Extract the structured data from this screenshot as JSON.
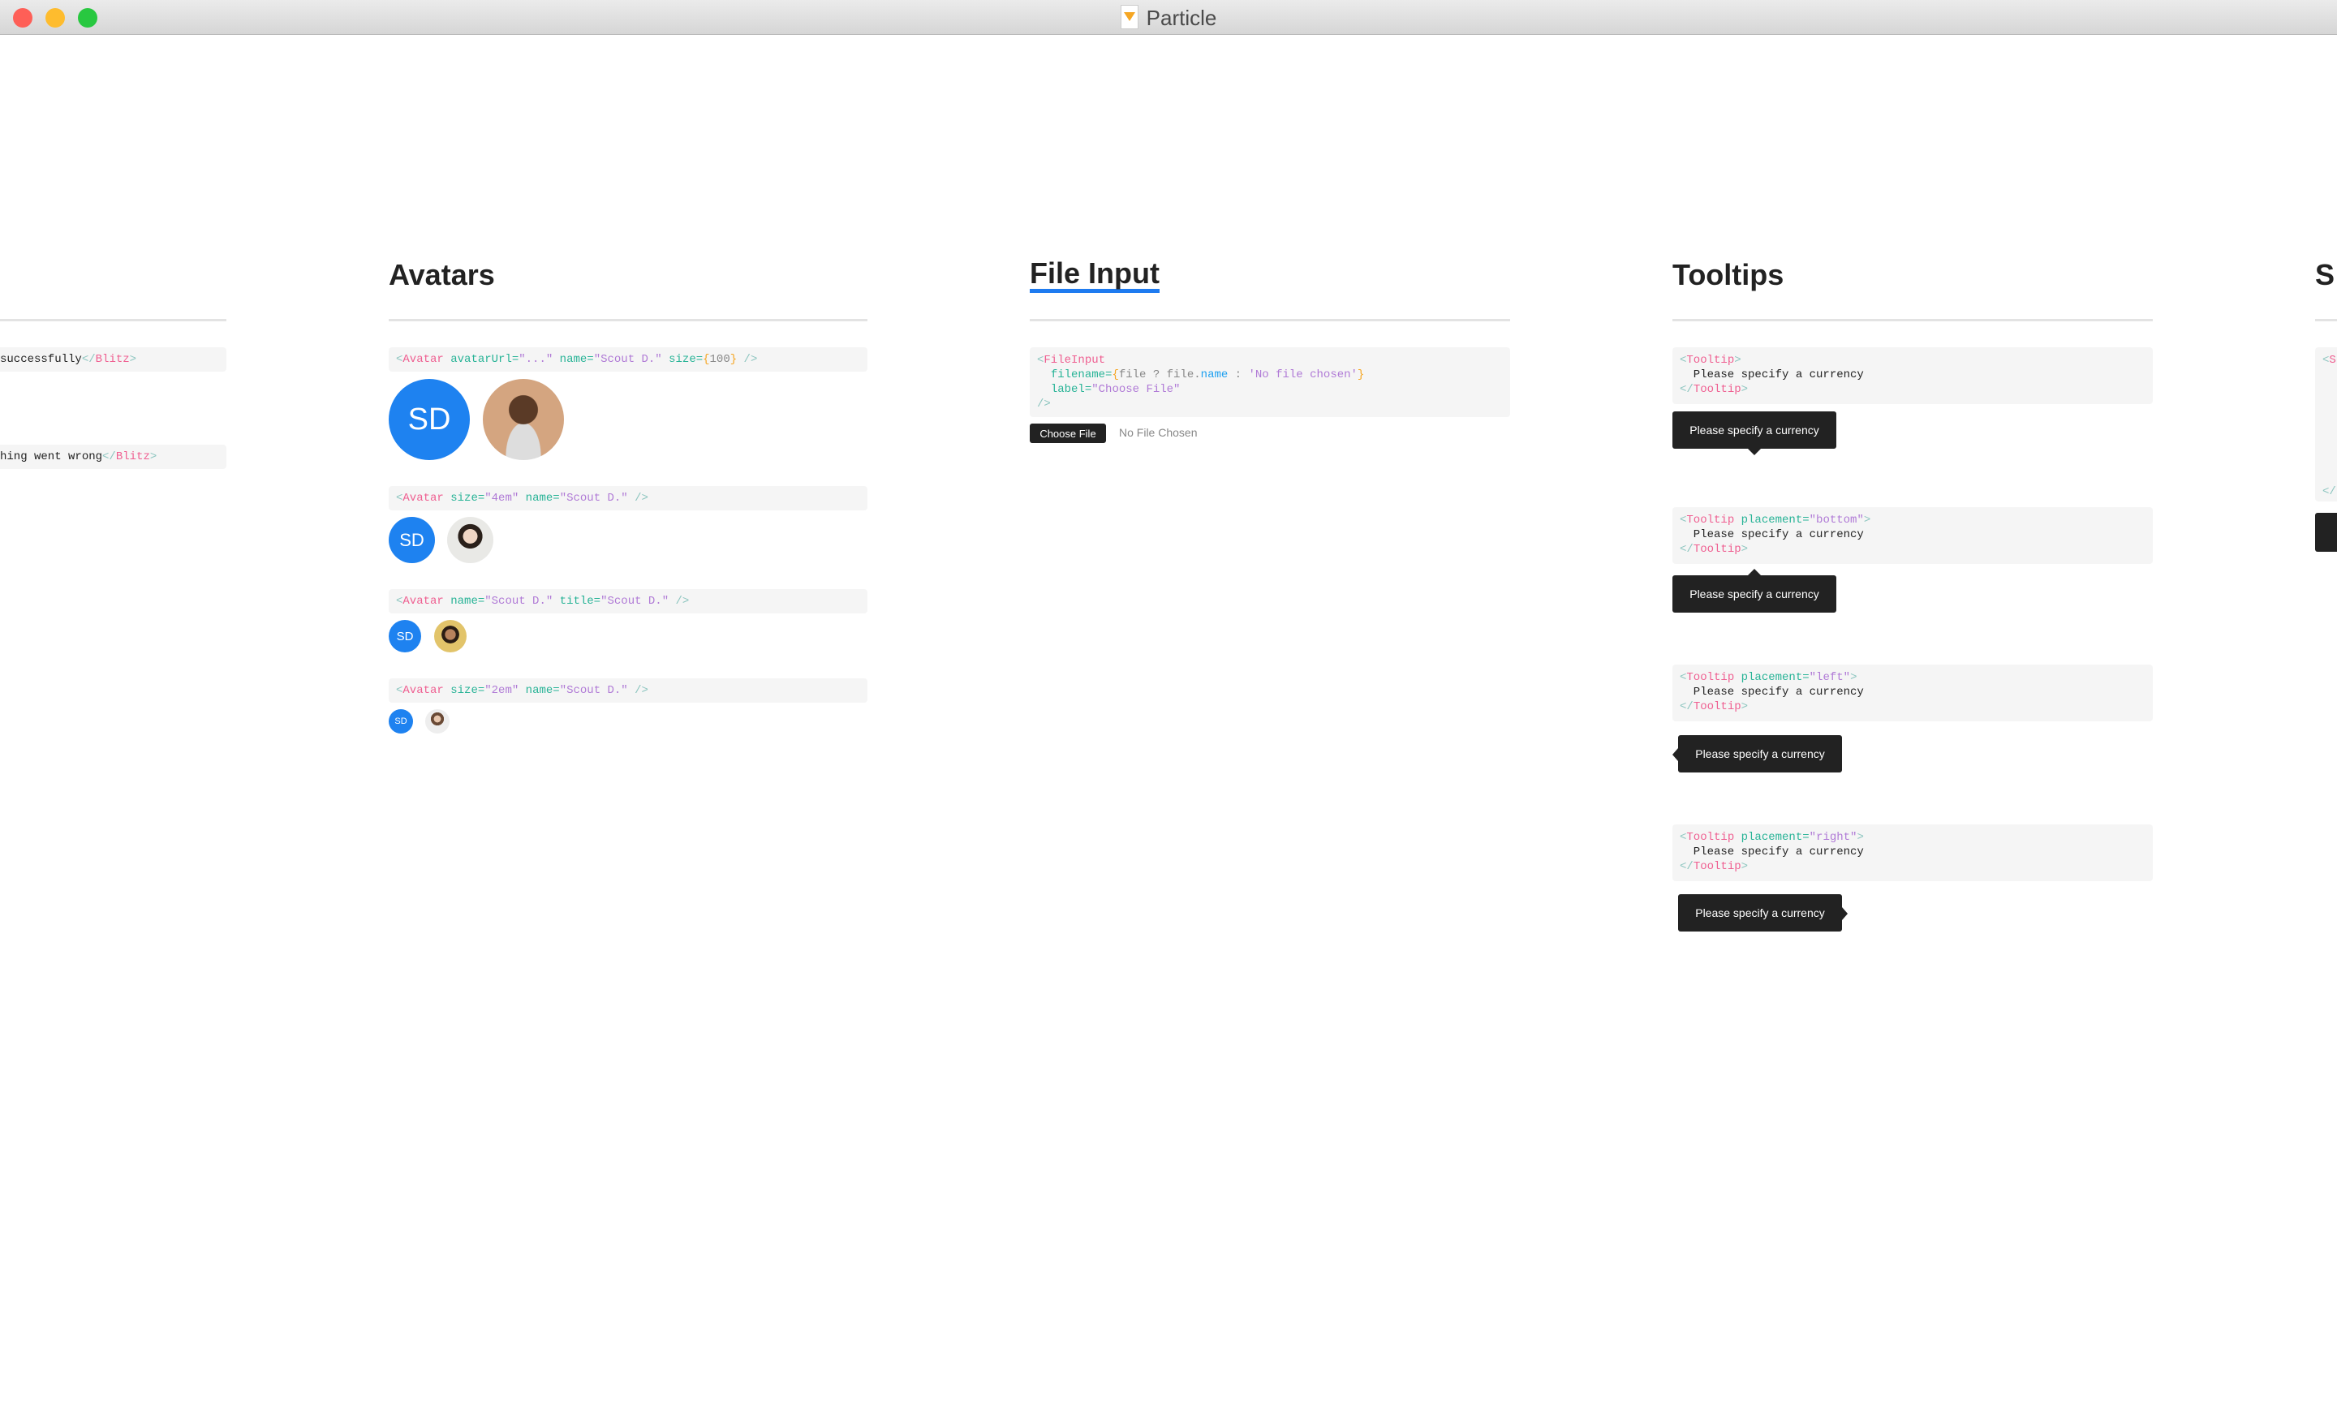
{
  "window": {
    "title": "Particle",
    "app_icon": "sketch-document-icon",
    "traffic_lights": [
      "#fe5f57",
      "#febc2e",
      "#28c840"
    ]
  },
  "colors": {
    "avatar_bg": "#1e82f0",
    "code_bg": "#f5f5f5",
    "tooltip_bg": "#222222",
    "heading_underline": "#1e7bf0"
  },
  "left_column": {
    "snippets": [
      [
        [
          [
            "text",
            "successfully"
          ],
          [
            "br",
            "</"
          ],
          [
            "tag",
            "Blitz"
          ],
          [
            "br",
            ">"
          ]
        ]
      ],
      [
        [
          [
            "text",
            "hing went wrong"
          ],
          [
            "br",
            "</"
          ],
          [
            "tag",
            "Blitz"
          ],
          [
            "br",
            ">"
          ]
        ]
      ]
    ]
  },
  "avatars": {
    "heading": "Avatars",
    "examples": [
      {
        "code": [
          [
            [
              "br",
              "<"
            ],
            [
              "tag",
              "Avatar"
            ],
            [
              "text",
              " "
            ],
            [
              "attr",
              "avatarUrl="
            ],
            [
              "str",
              "\"...\""
            ],
            [
              "text",
              " "
            ],
            [
              "attr",
              "name="
            ],
            [
              "str",
              "\"Scout D.\""
            ],
            [
              "text",
              " "
            ],
            [
              "attr",
              "size="
            ],
            [
              "brace",
              "{"
            ],
            [
              "plain",
              "100"
            ],
            [
              "brace",
              "}"
            ],
            [
              "br",
              " />"
            ]
          ]
        ],
        "initials": "SD"
      },
      {
        "code": [
          [
            [
              "br",
              "<"
            ],
            [
              "tag",
              "Avatar"
            ],
            [
              "text",
              " "
            ],
            [
              "attr",
              "size="
            ],
            [
              "str",
              "\"4em\""
            ],
            [
              "text",
              " "
            ],
            [
              "attr",
              "name="
            ],
            [
              "str",
              "\"Scout D.\""
            ],
            [
              "br",
              " />"
            ]
          ]
        ],
        "initials": "SD"
      },
      {
        "code": [
          [
            [
              "br",
              "<"
            ],
            [
              "tag",
              "Avatar"
            ],
            [
              "text",
              " "
            ],
            [
              "attr",
              "name="
            ],
            [
              "str",
              "\"Scout D.\""
            ],
            [
              "text",
              " "
            ],
            [
              "attr",
              "title="
            ],
            [
              "str",
              "\"Scout D.\""
            ],
            [
              "br",
              " />"
            ]
          ]
        ],
        "initials": "SD"
      },
      {
        "code": [
          [
            [
              "br",
              "<"
            ],
            [
              "tag",
              "Avatar"
            ],
            [
              "text",
              " "
            ],
            [
              "attr",
              "size="
            ],
            [
              "str",
              "\"2em\""
            ],
            [
              "text",
              " "
            ],
            [
              "attr",
              "name="
            ],
            [
              "str",
              "\"Scout D.\""
            ],
            [
              "br",
              " />"
            ]
          ]
        ],
        "initials": "SD"
      }
    ]
  },
  "file_input": {
    "heading": "File Input",
    "code": [
      [
        [
          "br",
          "<"
        ],
        [
          "tag",
          "FileInput"
        ]
      ],
      [
        [
          "text",
          "  "
        ],
        [
          "attr",
          "filename="
        ],
        [
          "brace",
          "{"
        ],
        [
          "plain",
          "file ? file."
        ],
        [
          "prop",
          "name"
        ],
        [
          "plain",
          " : "
        ],
        [
          "str",
          "'No file chosen'"
        ],
        [
          "brace",
          "}"
        ]
      ],
      [
        [
          "text",
          "  "
        ],
        [
          "attr",
          "label="
        ],
        [
          "str",
          "\"Choose File\""
        ]
      ],
      [
        [
          "br",
          "/>"
        ]
      ]
    ],
    "button_label": "Choose File",
    "status": "No File Chosen"
  },
  "tooltips": {
    "heading": "Tooltips",
    "examples": [
      {
        "code": [
          [
            [
              "br",
              "<"
            ],
            [
              "tag",
              "Tooltip"
            ],
            [
              "br",
              ">"
            ]
          ],
          [
            [
              "text",
              "  Please specify a currency"
            ]
          ],
          [
            [
              "br",
              "</"
            ],
            [
              "tag",
              "Tooltip"
            ],
            [
              "br",
              ">"
            ]
          ]
        ],
        "text": "Please specify a currency",
        "placement": "top"
      },
      {
        "code": [
          [
            [
              "br",
              "<"
            ],
            [
              "tag",
              "Tooltip"
            ],
            [
              "text",
              " "
            ],
            [
              "attr",
              "placement="
            ],
            [
              "str",
              "\"bottom\""
            ],
            [
              "br",
              ">"
            ]
          ],
          [
            [
              "text",
              "  Please specify a currency"
            ]
          ],
          [
            [
              "br",
              "</"
            ],
            [
              "tag",
              "Tooltip"
            ],
            [
              "br",
              ">"
            ]
          ]
        ],
        "text": "Please specify a currency",
        "placement": "bottom"
      },
      {
        "code": [
          [
            [
              "br",
              "<"
            ],
            [
              "tag",
              "Tooltip"
            ],
            [
              "text",
              " "
            ],
            [
              "attr",
              "placement="
            ],
            [
              "str",
              "\"left\""
            ],
            [
              "br",
              ">"
            ]
          ],
          [
            [
              "text",
              "  Please specify a currency"
            ]
          ],
          [
            [
              "br",
              "</"
            ],
            [
              "tag",
              "Tooltip"
            ],
            [
              "br",
              ">"
            ]
          ]
        ],
        "text": "Please specify a currency",
        "placement": "left"
      },
      {
        "code": [
          [
            [
              "br",
              "<"
            ],
            [
              "tag",
              "Tooltip"
            ],
            [
              "text",
              " "
            ],
            [
              "attr",
              "placement="
            ],
            [
              "str",
              "\"right\""
            ],
            [
              "br",
              ">"
            ]
          ],
          [
            [
              "text",
              "  Please specify a currency"
            ]
          ],
          [
            [
              "br",
              "</"
            ],
            [
              "tag",
              "Tooltip"
            ],
            [
              "br",
              ">"
            ]
          ]
        ],
        "text": "Please specify a currency",
        "placement": "right"
      }
    ]
  },
  "next_column": {
    "heading": "S",
    "code": [
      [
        [
          "br",
          "<"
        ],
        [
          "tag",
          "S"
        ]
      ],
      [],
      [],
      [],
      [],
      [],
      [],
      [],
      [],
      [
        [
          "br",
          "</"
        ]
      ]
    ]
  }
}
